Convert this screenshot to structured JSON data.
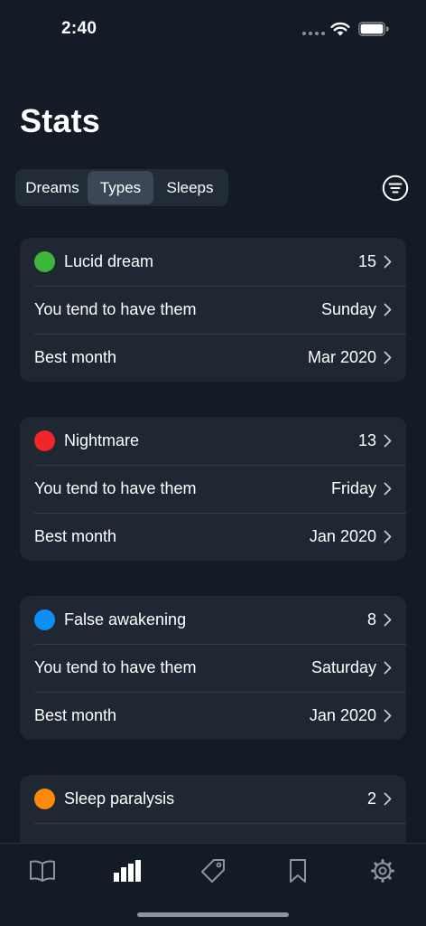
{
  "status": {
    "time": "2:40"
  },
  "header": {
    "title": "Stats"
  },
  "segments": [
    {
      "label": "Dreams"
    },
    {
      "label": "Types"
    },
    {
      "label": "Sleeps"
    }
  ],
  "selected_segment": "Types",
  "colors": {
    "accent_green": "#3cb93c",
    "accent_red": "#f0262a",
    "accent_blue": "#0e8ff5",
    "accent_orange": "#fd8a0a",
    "background": "#131c26",
    "card": "#1f2832"
  },
  "cards": [
    {
      "name": "Lucid dream",
      "count": "15",
      "tend_label": "You tend to have them",
      "tend_value": "Sunday",
      "best_label": "Best month",
      "best_value": "Mar 2020"
    },
    {
      "name": "Nightmare",
      "count": "13",
      "tend_label": "You tend to have them",
      "tend_value": "Friday",
      "best_label": "Best month",
      "best_value": "Jan 2020"
    },
    {
      "name": "False awakening",
      "count": "8",
      "tend_label": "You tend to have them",
      "tend_value": "Saturday",
      "best_label": "Best month",
      "best_value": "Jan 2020"
    },
    {
      "name": "Sleep paralysis",
      "count": "2"
    }
  ],
  "tabbar": {
    "items": [
      {
        "icon": "book-icon"
      },
      {
        "icon": "bar-chart-icon",
        "active": true
      },
      {
        "icon": "tag-icon"
      },
      {
        "icon": "bookmark-icon"
      },
      {
        "icon": "gear-icon"
      }
    ]
  }
}
